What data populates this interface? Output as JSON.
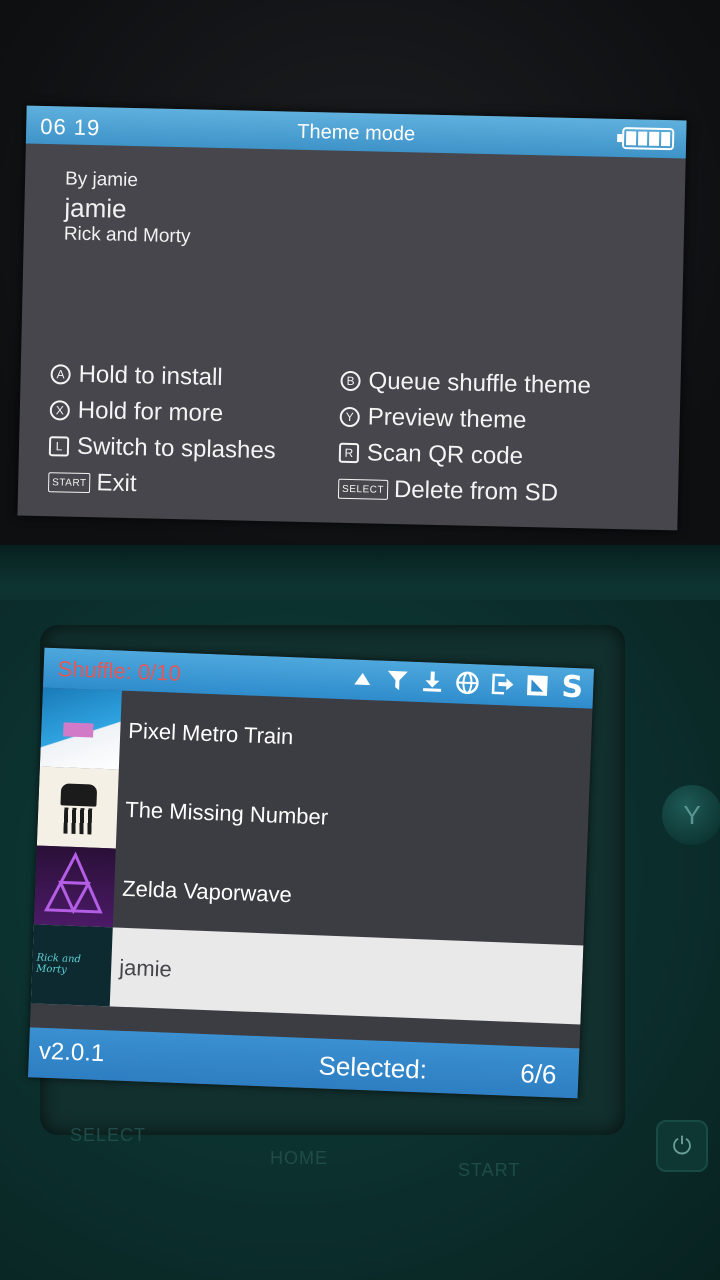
{
  "top_screen": {
    "time": "06 19",
    "title": "Theme mode",
    "author_line": "By jamie",
    "theme_name": "jamie",
    "theme_description": "Rick and Morty",
    "controls_left": [
      {
        "key": "A",
        "label": "Hold to install"
      },
      {
        "key": "X",
        "label": "Hold for more"
      },
      {
        "key": "L",
        "label": "Switch to splashes"
      },
      {
        "key": "START",
        "label": "Exit"
      }
    ],
    "controls_right": [
      {
        "key": "B",
        "label": "Queue shuffle theme"
      },
      {
        "key": "Y",
        "label": "Preview theme"
      },
      {
        "key": "R",
        "label": "Scan QR code"
      },
      {
        "key": "SELECT",
        "label": "Delete from SD"
      }
    ]
  },
  "bottom_screen": {
    "shuffle_status": "Shuffle: 0/10",
    "toolbar_icons": [
      "arrow-up-icon",
      "filter-icon",
      "download-icon",
      "browse-icon",
      "exit-icon",
      "preview-icon",
      "sort-icon"
    ],
    "sort_glyph": "S",
    "items": [
      {
        "name": "Pixel Metro Train",
        "selected": false
      },
      {
        "name": "The Missing Number",
        "selected": false
      },
      {
        "name": "Zelda Vaporwave",
        "selected": false
      },
      {
        "name": "jamie",
        "selected": true
      }
    ],
    "thumb_4_text": "Rick and Morty",
    "version": "v2.0.1",
    "selected_label": "Selected:",
    "selected_count": "6/6"
  },
  "hardware": {
    "y_button_label": "Y",
    "power_glyph": "⏻",
    "select_label": "SELECT",
    "home_label": "HOME",
    "start_label": "START"
  },
  "colors": {
    "accent_blue": "#3e93c8",
    "screen_bg": "#46464c",
    "shuffle_red": "#e05959",
    "selected_row": "#e9e9ea"
  }
}
